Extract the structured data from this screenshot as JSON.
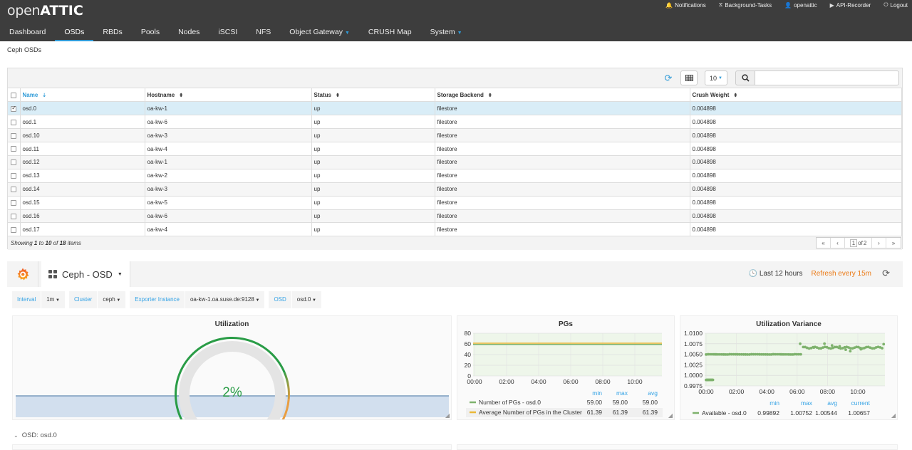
{
  "app": {
    "logo_open": "open",
    "logo_attic": "ATTIC",
    "utility": [
      {
        "icon": "bell-icon",
        "glyph": "🔔",
        "label": "Notifications"
      },
      {
        "icon": "hourglass-icon",
        "glyph": "⧖",
        "label": "Background-Tasks"
      },
      {
        "icon": "user-icon",
        "glyph": "👤",
        "label": "openattic"
      },
      {
        "icon": "play-icon",
        "glyph": "▶",
        "label": "API-Recorder"
      },
      {
        "icon": "logout-icon",
        "glyph": "⏻",
        "label": "Logout"
      }
    ],
    "nav": [
      {
        "label": "Dashboard"
      },
      {
        "label": "OSDs"
      },
      {
        "label": "RBDs"
      },
      {
        "label": "Pools"
      },
      {
        "label": "Nodes"
      },
      {
        "label": "iSCSI"
      },
      {
        "label": "NFS"
      },
      {
        "label": "Object Gateway"
      },
      {
        "label": "CRUSH Map"
      },
      {
        "label": "System"
      }
    ],
    "active_nav": "OSDs"
  },
  "breadcrumb": "Ceph OSDs",
  "table": {
    "page_size": "10",
    "search_placeholder": "",
    "columns": [
      "Name",
      "Hostname",
      "Status",
      "Storage Backend",
      "Crush Weight"
    ],
    "sorted_column": "Name",
    "rows": [
      {
        "name": "osd.0",
        "host": "oa-kw-1",
        "status": "up",
        "backend": "filestore",
        "weight": "0.004898",
        "selected": true
      },
      {
        "name": "osd.1",
        "host": "oa-kw-6",
        "status": "up",
        "backend": "filestore",
        "weight": "0.004898",
        "selected": false
      },
      {
        "name": "osd.10",
        "host": "oa-kw-3",
        "status": "up",
        "backend": "filestore",
        "weight": "0.004898",
        "selected": false
      },
      {
        "name": "osd.11",
        "host": "oa-kw-4",
        "status": "up",
        "backend": "filestore",
        "weight": "0.004898",
        "selected": false
      },
      {
        "name": "osd.12",
        "host": "oa-kw-1",
        "status": "up",
        "backend": "filestore",
        "weight": "0.004898",
        "selected": false
      },
      {
        "name": "osd.13",
        "host": "oa-kw-2",
        "status": "up",
        "backend": "filestore",
        "weight": "0.004898",
        "selected": false
      },
      {
        "name": "osd.14",
        "host": "oa-kw-3",
        "status": "up",
        "backend": "filestore",
        "weight": "0.004898",
        "selected": false
      },
      {
        "name": "osd.15",
        "host": "oa-kw-5",
        "status": "up",
        "backend": "filestore",
        "weight": "0.004898",
        "selected": false
      },
      {
        "name": "osd.16",
        "host": "oa-kw-6",
        "status": "up",
        "backend": "filestore",
        "weight": "0.004898",
        "selected": false
      },
      {
        "name": "osd.17",
        "host": "oa-kw-4",
        "status": "up",
        "backend": "filestore",
        "weight": "0.004898",
        "selected": false
      }
    ],
    "footer": {
      "showing": "Showing",
      "from": "1",
      "to_word": "to",
      "to": "10",
      "of_word": "of",
      "total": "18",
      "items": "items"
    },
    "pager": {
      "current": "1",
      "of": "of",
      "pages": "2"
    }
  },
  "grafana": {
    "dashboard_title": "Ceph - OSD",
    "time_range": "Last 12 hours",
    "refresh": "Refresh every 15m",
    "variables": [
      {
        "label": "Interval",
        "value": "1m"
      },
      {
        "label": "Cluster",
        "value": "ceph"
      },
      {
        "label": "Exporter Instance",
        "value": "oa-kw-1.oa.suse.de:9128"
      },
      {
        "label": "OSD",
        "value": "osd.0"
      }
    ],
    "row_title": "OSD: osd.0",
    "colors": {
      "green": "#299c46",
      "orange": "#e99e42",
      "red": "#d44a3a",
      "series_green": "#7eb26d",
      "series_yellow": "#eab839",
      "accent_blue": "#33a2e5"
    }
  },
  "chart_data": [
    {
      "type": "gauge",
      "title": "Utilization",
      "value": 2,
      "display": "2%",
      "range": [
        0,
        100
      ],
      "thresholds": [
        85,
        95
      ]
    },
    {
      "type": "line",
      "title": "PGs",
      "x_ticks": [
        "00:00",
        "02:00",
        "04:00",
        "06:00",
        "08:00",
        "10:00"
      ],
      "y_ticks": [
        "80",
        "60",
        "40",
        "20",
        "0"
      ],
      "ylim": [
        0,
        80
      ],
      "legend_headers": [
        "min",
        "max",
        "avg"
      ],
      "series": [
        {
          "name": "Number of PGs - osd.0",
          "color": "#7eb26d",
          "value": 59.0,
          "min": "59.00",
          "max": "59.00",
          "avg": "59.00"
        },
        {
          "name": "Average Number of PGs in the Cluster",
          "color": "#eab839",
          "value": 61.39,
          "min": "61.39",
          "max": "61.39",
          "avg": "61.39"
        }
      ]
    },
    {
      "type": "scatter",
      "title": "Utilization Variance",
      "x_ticks": [
        "00:00",
        "02:00",
        "04:00",
        "06:00",
        "08:00",
        "10:00"
      ],
      "y_ticks": [
        "1.0100",
        "1.0075",
        "1.0050",
        "1.0025",
        "1.0000",
        "0.9975"
      ],
      "ylim": [
        0.9975,
        1.01
      ],
      "legend_headers": [
        "min",
        "max",
        "avg",
        "current"
      ],
      "series": [
        {
          "name": "Available - osd.0",
          "color": "#7eb26d",
          "min": "0.99892",
          "max": "1.00752",
          "avg": "1.00544",
          "current": "1.00657"
        }
      ]
    }
  ]
}
